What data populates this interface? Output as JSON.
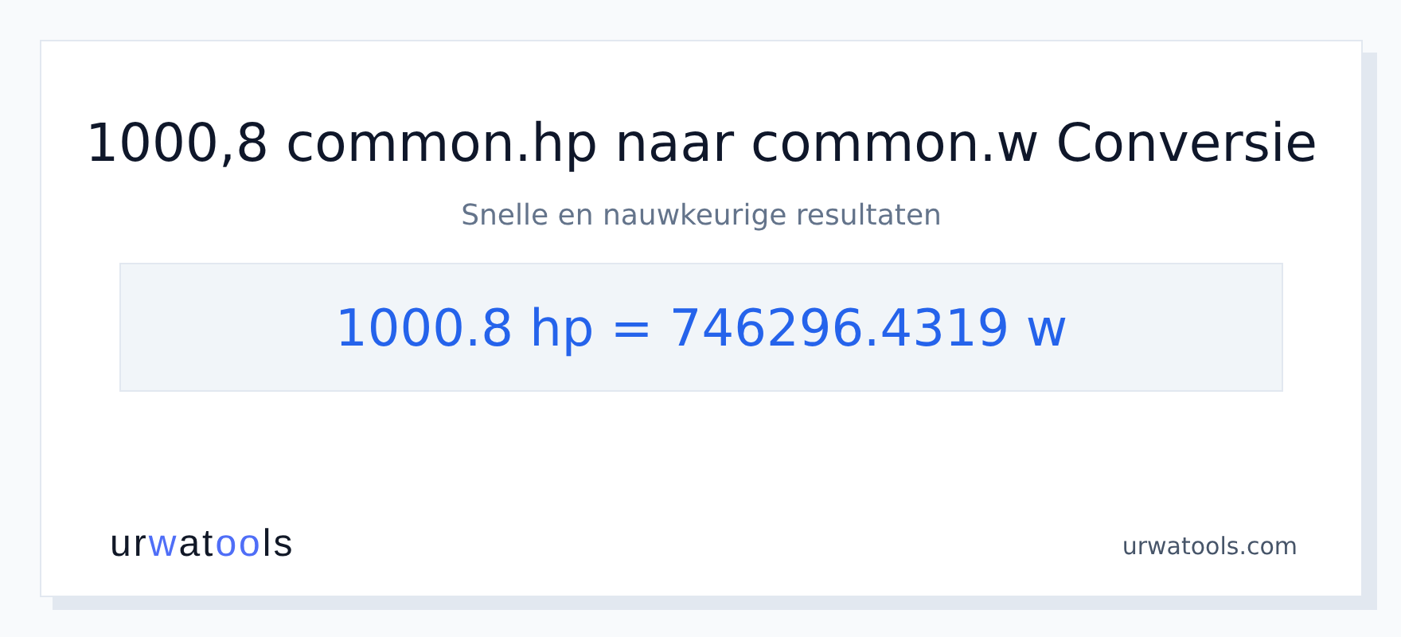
{
  "title": "1000,8 common.hp naar common.w Conversie",
  "subtitle": "Snelle en nauwkeurige resultaten",
  "result": "1000.8 hp = 746296.4319 w",
  "logo": [
    {
      "text": "ur",
      "highlight": false
    },
    {
      "text": "w",
      "highlight": true
    },
    {
      "text": "at",
      "highlight": false
    },
    {
      "text": "oo",
      "highlight": true
    },
    {
      "text": "ls",
      "highlight": false
    }
  ],
  "site": "urwatools.com"
}
